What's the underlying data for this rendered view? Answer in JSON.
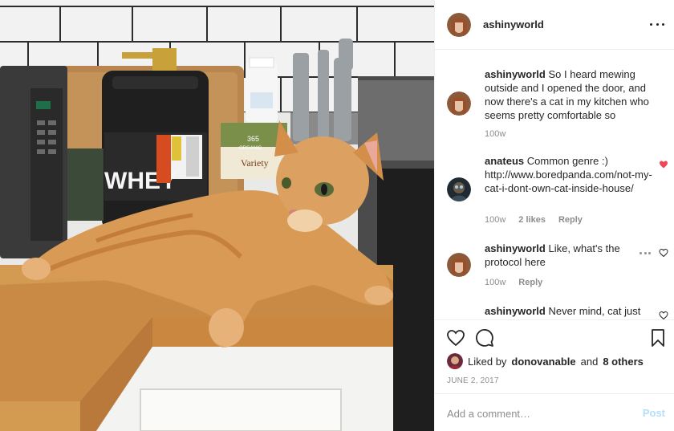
{
  "post": {
    "username": "ashinyworld",
    "more_icon": "more-horizontal-icon"
  },
  "photo": {
    "jar_label": "WHEY",
    "box_brand": "365",
    "box_sub": "ORGANIC",
    "box_label": "Variety"
  },
  "comments": [
    {
      "username": "ashinyworld",
      "text": "So I heard mewing outside and I opened the door, and now there's a cat in my kitchen who seems pretty comfortable so",
      "time": "100w",
      "likes": "",
      "reply": "",
      "liked": false
    },
    {
      "username": "anateus",
      "text": "Common genre :) http://www.boredpanda.com/not-my-cat-i-dont-own-cat-inside-house/",
      "time": "100w",
      "likes": "2 likes",
      "reply": "Reply",
      "liked": true
    },
    {
      "username": "ashinyworld",
      "text": "Like, what's the protocol here",
      "time": "100w",
      "likes": "",
      "reply": "Reply",
      "liked": false
    },
    {
      "username": "ashinyworld",
      "text": "Never mind, cat just",
      "time": "",
      "likes": "",
      "reply": "",
      "liked": false
    }
  ],
  "likes": {
    "prefix": "Liked by",
    "user": "donovanable",
    "connector": "and",
    "others": "8 others"
  },
  "date": "JUNE 2, 2017",
  "add_comment": {
    "placeholder": "Add a comment…",
    "post_label": "Post"
  },
  "colors": {
    "accent_blue_disabled": "#b2dffc",
    "heart_red": "#ed4956",
    "text_primary": "#262626",
    "text_secondary": "#8e8e8e"
  }
}
